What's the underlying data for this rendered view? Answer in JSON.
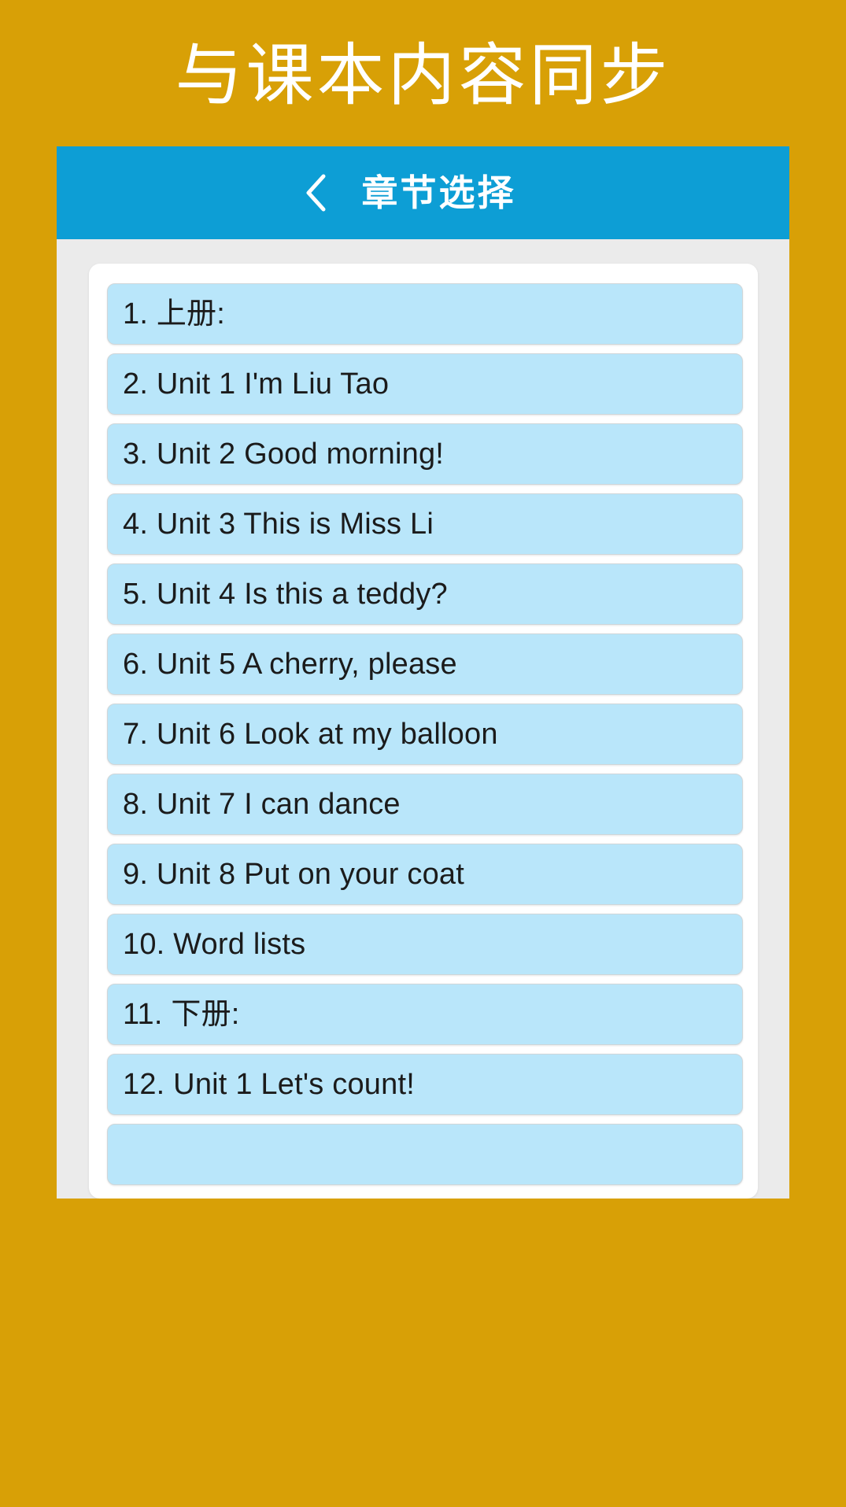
{
  "promo": {
    "headline": "与课本内容同步",
    "background_color": "#d8a006",
    "text_color": "#ffffff"
  },
  "app_bar": {
    "back_icon": "chevron-left-icon",
    "title": "章节选择",
    "background_color": "#0d9ed5",
    "text_color": "#ffffff"
  },
  "content": {
    "background_color": "#ebebeb",
    "card_color": "#ffffff",
    "item_color": "#b9e6fa",
    "item_text_color": "#1b1b1b"
  },
  "chapter_list": {
    "items": [
      {
        "label": "1. 上册:"
      },
      {
        "label": "2. Unit 1 I'm Liu Tao"
      },
      {
        "label": "3. Unit 2 Good morning!"
      },
      {
        "label": "4. Unit 3 This is Miss Li"
      },
      {
        "label": "5. Unit 4 Is this a teddy?"
      },
      {
        "label": "6. Unit 5 A cherry, please"
      },
      {
        "label": "7. Unit 6 Look at my balloon"
      },
      {
        "label": "8. Unit 7 I can dance"
      },
      {
        "label": "9. Unit 8 Put on your coat"
      },
      {
        "label": "10. Word lists"
      },
      {
        "label": "11. 下册:"
      },
      {
        "label": "12. Unit 1 Let's count!"
      },
      {
        "label": ""
      }
    ]
  }
}
